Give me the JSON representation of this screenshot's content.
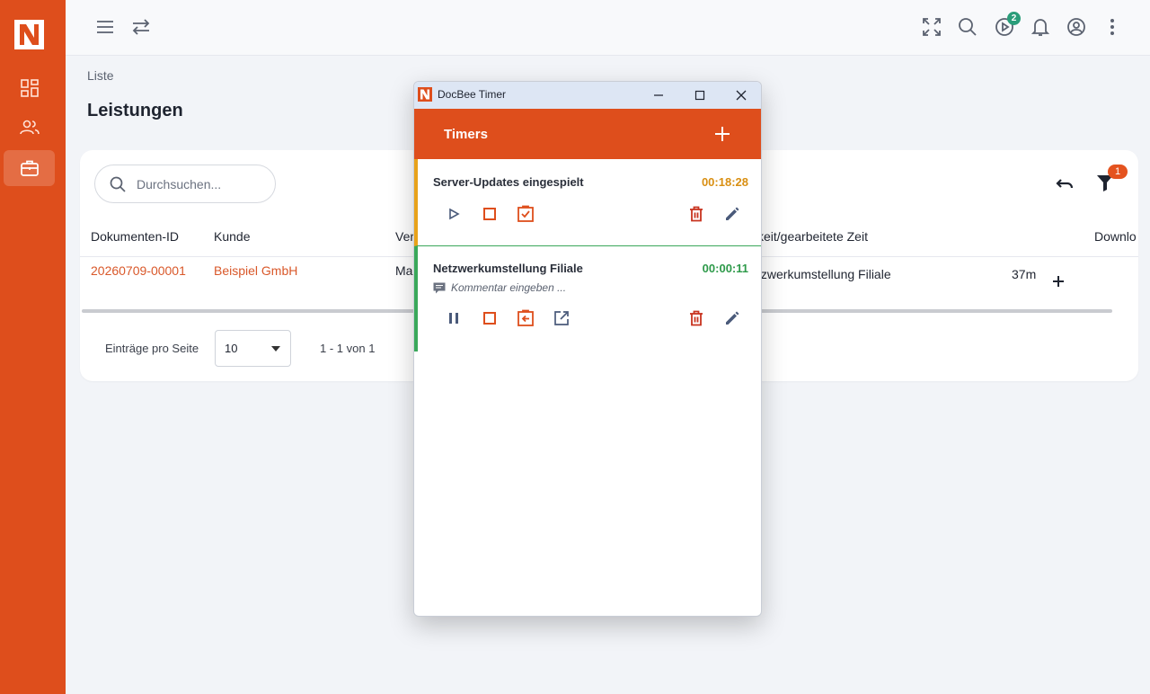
{
  "app": {
    "nav_items": [
      "dashboard",
      "contacts",
      "services"
    ]
  },
  "breadcrumb": "Liste",
  "page_title": "Leistungen",
  "header": {
    "timer_badge": "2"
  },
  "search": {
    "placeholder": "Durchsuchen..."
  },
  "filter_badge": "1",
  "table": {
    "columns": [
      "Dokumenten-ID",
      "Kunde",
      "Ver",
      "keit/gearbeitete Zeit",
      "Downlo"
    ],
    "rows": [
      {
        "id": "20260709-00001",
        "customer": "Beispiel GmbH",
        "ver": "Ma",
        "activity": "tzwerkumstellung Filiale",
        "duration": "37m"
      }
    ]
  },
  "pagination": {
    "label": "Einträge pro Seite",
    "page_size": "10",
    "range": "1 - 1 von 1"
  },
  "timer_window": {
    "title": "DocBee Timer",
    "header": "Timers",
    "timers": [
      {
        "name": "Server-Updates eingespielt",
        "time": "00:18:28",
        "color": "#d98f12",
        "state": "paused"
      },
      {
        "name": "Netzwerkumstellung Filiale",
        "time": "00:00:11",
        "color": "#2e9a4a",
        "state": "running",
        "comment_placeholder": "Kommentar eingeben ..."
      }
    ]
  },
  "colors": {
    "brand": "#de4e1c",
    "accent_link": "#d9582a",
    "danger": "#c8331f"
  }
}
